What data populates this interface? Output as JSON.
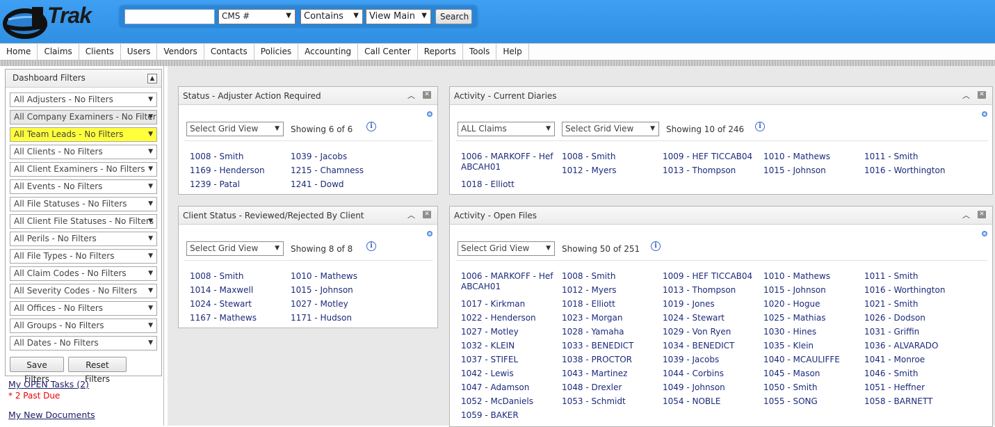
{
  "app": {
    "logo_text": "Trak"
  },
  "search": {
    "input_value": "",
    "field_select": "CMS #",
    "operator_select": "Contains",
    "view_select": "View Main",
    "button_label": "Search"
  },
  "nav": [
    "Home",
    "Claims",
    "Clients",
    "Users",
    "Vendors",
    "Contacts",
    "Policies",
    "Accounting",
    "Call Center",
    "Reports",
    "Tools",
    "Help"
  ],
  "sidebar": {
    "title": "Dashboard Filters",
    "filters": [
      "All Adjusters - No Filters",
      "All Company Examiners - No Filters",
      "All Team Leads - No Filters",
      "All Clients - No Filters",
      "All Client Examiners - No Filters",
      "All Events - No Filters",
      "All File Statuses - No Filters",
      "All Client File Statuses - No Filters",
      "All Perils - No Filters",
      "All File Types - No Filters",
      "All Claim Codes - No Filters",
      "All Severity Codes - No Filters",
      "All Offices - No Filters",
      "All Groups - No Filters",
      "All Dates - No Filters"
    ],
    "save_label": "Save Filters",
    "reset_label": "Reset Filters",
    "tasks_link": "My OPEN Tasks (2)",
    "past_due": "* 2 Past Due",
    "docs_link": "My New Documents",
    "highlight_color": "#ffff3c"
  },
  "panels": {
    "status": {
      "title": "Status - Adjuster Action Required",
      "grid_view": "Select Grid View",
      "showing": "Showing  6 of 6",
      "items": [
        "1008 - Smith",
        "1039 - Jacobs",
        "1169 - Henderson",
        "1215 - Chamness",
        "1239 - Patal",
        "1241 - Dowd"
      ]
    },
    "client_status": {
      "title": "Client Status - Reviewed/Rejected By Client",
      "grid_view": "Select Grid View",
      "showing": "Showing  8 of 8",
      "items": [
        "1008 - Smith",
        "1010 - Mathews",
        "1014 - Maxwell",
        "1015 - Johnson",
        "1024 - Stewart",
        "1027 - Motley",
        "1167 - Mathews",
        "1171 - Hudson"
      ]
    },
    "diaries": {
      "title": "Activity - Current Diaries",
      "claims_filter": "ALL Claims",
      "grid_view": "Select Grid View",
      "showing": "Showing  10 of 246",
      "items": [
        "1006 - MARKOFF - Hef ABCAH01",
        "1008 - Smith",
        "1009 - HEF TICCAB04",
        "1010 - Mathews",
        "1011 - Smith",
        "1018 - Elliott",
        "1012 - Myers",
        "1013 - Thompson",
        "1015 - Johnson",
        "1016 - Worthington"
      ]
    },
    "open_files": {
      "title": "Activity - Open Files",
      "grid_view": "Select Grid View",
      "showing": "Showing  50 of 251",
      "items": [
        "1006 - MARKOFF - Hef ABCAH01",
        "1008 - Smith",
        "1009 - HEF TICCAB04",
        "1010 - Mathews",
        "1011 - Smith",
        "1012 - Myers",
        "1013 - Thompson",
        "1015 - Johnson",
        "1016 - Worthington",
        "1017 - Kirkman",
        "1018 - Elliott",
        "1019 - Jones",
        "1020 - Hogue",
        "1021 - Smith",
        "1022 - Henderson",
        "1023 - Morgan",
        "1024 - Stewart",
        "1025 - Mathias",
        "1026 - Dodson",
        "1027 - Motley",
        "1028 - Yamaha",
        "1029 - Von Ryen",
        "1030 - Hines",
        "1031 - Griffin",
        "1032 - KLEIN",
        "1033 - BENEDICT",
        "1034 - BENEDICT",
        "1035 - Klein",
        "1036 - ALVARADO",
        "1037 - STIFEL",
        "1038 - PROCTOR",
        "1039 - Jacobs",
        "1040 - MCAULIFFE",
        "1041 - Monroe",
        "1042 - Lewis",
        "1043 - Martinez",
        "1044 - Corbins",
        "1045 - Mason",
        "1046 - Smith",
        "1047 - Adamson",
        "1048 - Drexler",
        "1049 - Johnson",
        "1050 - Smith",
        "1051 - Heffner",
        "1052 - McDaniels",
        "1053 - Schmidt",
        "1054 - NOBLE",
        "1055 - SONG",
        "1058 - BARNETT",
        "1059 - BAKER"
      ]
    }
  }
}
